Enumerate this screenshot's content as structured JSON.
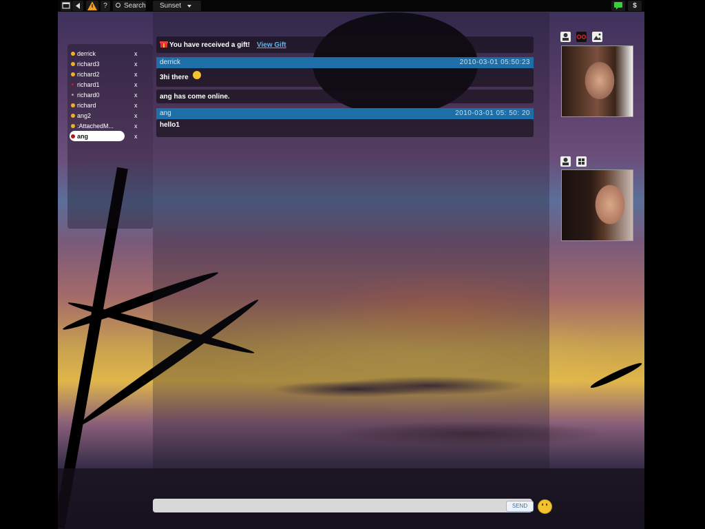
{
  "topbar": {
    "search_label": "Search",
    "theme": "Sunset",
    "help": "?",
    "dollar": "$"
  },
  "contacts": [
    {
      "name": "derrick",
      "status_color": "#f0b020"
    },
    {
      "name": "richard3",
      "status_color": "#f0b020"
    },
    {
      "name": "richard2",
      "status_color": "#f0b020"
    },
    {
      "name": "richard1",
      "status_color": "#d02020"
    },
    {
      "name": "richard0",
      "status_color": "#a0a0a0"
    },
    {
      "name": "richard",
      "status_color": "#f0b020"
    },
    {
      "name": "ang2",
      "status_color": "#f0b020"
    },
    {
      "name": ":AttachedM...",
      "status_color": "#f0b020"
    },
    {
      "name": "ang",
      "status_color": "#b01818"
    }
  ],
  "close_label": "x",
  "chat": {
    "gift_text": "You have received a gift!",
    "gift_link": "View Gift",
    "msg1_user": "derrick",
    "msg1_time": "2010-03-01 05:50:23",
    "msg1_text": "3hi there",
    "online_text": "ang has come online.",
    "msg2_user": "ang",
    "msg2_time": "2010-03-01 05: 50: 20",
    "msg2_text": "hello1"
  },
  "input": {
    "send_label": "SEND"
  }
}
